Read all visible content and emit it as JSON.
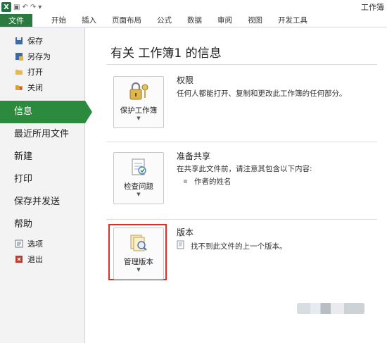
{
  "app": {
    "window_title": "工作簿",
    "logo_letter": "X"
  },
  "ribbon": {
    "file_tab": "文件",
    "tabs": [
      "开始",
      "插入",
      "页面布局",
      "公式",
      "数据",
      "审阅",
      "视图",
      "开发工具"
    ]
  },
  "nav": {
    "save": "保存",
    "save_as": "另存为",
    "open": "打开",
    "close": "关闭",
    "info": "信息",
    "recent": "最近所用文件",
    "new": "新建",
    "print": "打印",
    "save_send": "保存并发送",
    "help": "帮助",
    "options": "选项",
    "exit": "退出"
  },
  "info": {
    "title": "有关 工作簿1 的信息",
    "permissions": {
      "button": "保护工作簿",
      "heading": "权限",
      "desc": "任何人都能打开、复制和更改此工作簿的任何部分。"
    },
    "prepare": {
      "button": "检查问题",
      "heading": "准备共享",
      "desc": "在共享此文件前，请注意其包含以下内容:",
      "item": "作者的姓名"
    },
    "versions": {
      "button": "管理版本",
      "heading": "版本",
      "desc": "找不到此文件的上一个版本。"
    }
  },
  "colors": {
    "accent_green": "#2b8a3e",
    "highlight_red": "#d9302c"
  }
}
